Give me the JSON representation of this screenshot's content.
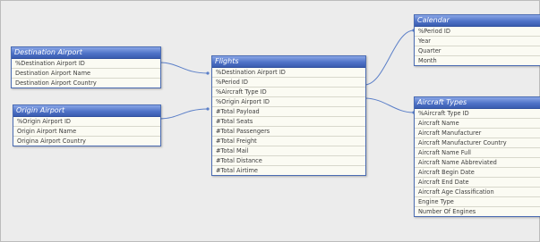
{
  "tables": {
    "destination_airport": {
      "title": "Destination Airport",
      "fields": [
        "%Destination Airport ID",
        "Destination Airport Name",
        "Destination Airport Country"
      ]
    },
    "origin_airport": {
      "title": "Origin Airport",
      "fields": [
        "%Origin Airport ID",
        "Origin Airport Name",
        "Origina Airport Country"
      ]
    },
    "flights": {
      "title": "Flights",
      "fields": [
        "%Destination Airport ID",
        "%Period ID",
        "%Aircraft Type ID",
        "%Origin Airport ID",
        "#Total Payload",
        "#Total Seats",
        "#Total Passengers",
        "#Total Freight",
        "#Total Mail",
        "#Total Distance",
        "#Total Airtime"
      ]
    },
    "calendar": {
      "title": "Calendar",
      "fields": [
        "%Period ID",
        "Year",
        "Quarter",
        "Month"
      ]
    },
    "aircraft_types": {
      "title": "Aircraft Types",
      "fields": [
        "%Aircraft Type ID",
        "Aircraft Name",
        "Aircraft Manufacturer",
        "Aircraft Manufacturer Country",
        "Aircraft Name Full",
        "Aircraft Name Abbreviated",
        "Aircraft Begin Date",
        "Aircraft End Date",
        "Aircraft Age Classification",
        "Engine Type",
        "Number Of Engines"
      ]
    }
  },
  "colors": {
    "header": "#4f73c8",
    "link": "#5b7fc8",
    "field_bg": "#fbfbf3"
  }
}
